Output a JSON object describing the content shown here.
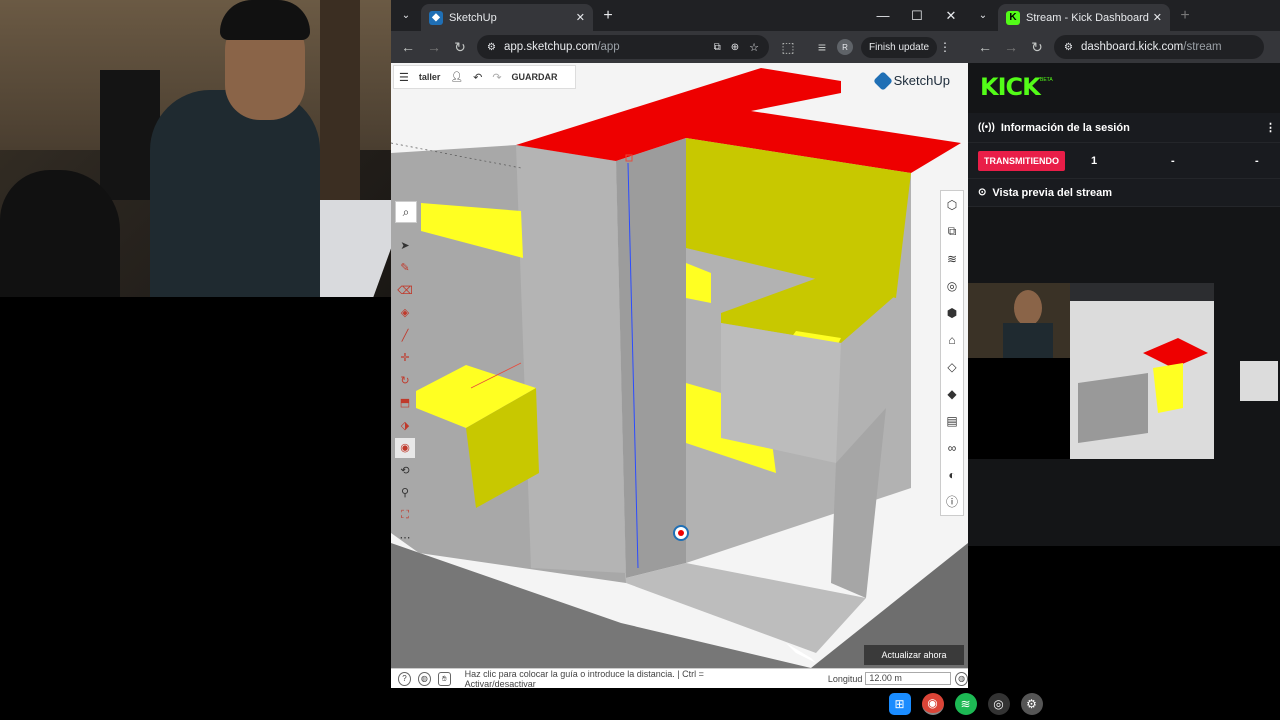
{
  "browser1": {
    "tab_title": "SketchUp",
    "url_host": "app.sketchup.com",
    "url_path": "/app",
    "profile_initial": "R",
    "finish_update": "Finish update"
  },
  "sketchup": {
    "project_name": "taller",
    "save_label": "GUARDAR",
    "logo_text": "SketchUp",
    "update_now": "Actualizar ahora",
    "status_message": "Haz clic para colocar la guía o introduce la distancia. | Ctrl = Activar/desactivar",
    "length_label": "Longitud",
    "length_value": "12.00 m"
  },
  "browser2": {
    "tab_title": "Stream - Kick Dashboard",
    "url_host": "dashboard.kick.com",
    "url_path": "/stream"
  },
  "kick": {
    "logo": "KICK",
    "beta": "BETA",
    "session_info": "Información de la sesión",
    "live_badge": "TRANSMITIENDO",
    "viewers": "1",
    "stat2": "-",
    "stat3": "-",
    "stream_preview": "Vista previa del stream"
  },
  "colors": {
    "accent_kick": "#53fc18",
    "live_red": "#e91e48",
    "model_red": "#ee0000",
    "model_yellow": "#ffff22",
    "model_olive": "#c8c800"
  },
  "taskbar_icons": [
    "windows-icon",
    "chrome-icon",
    "spotify-icon",
    "obs-icon",
    "settings-icon"
  ]
}
